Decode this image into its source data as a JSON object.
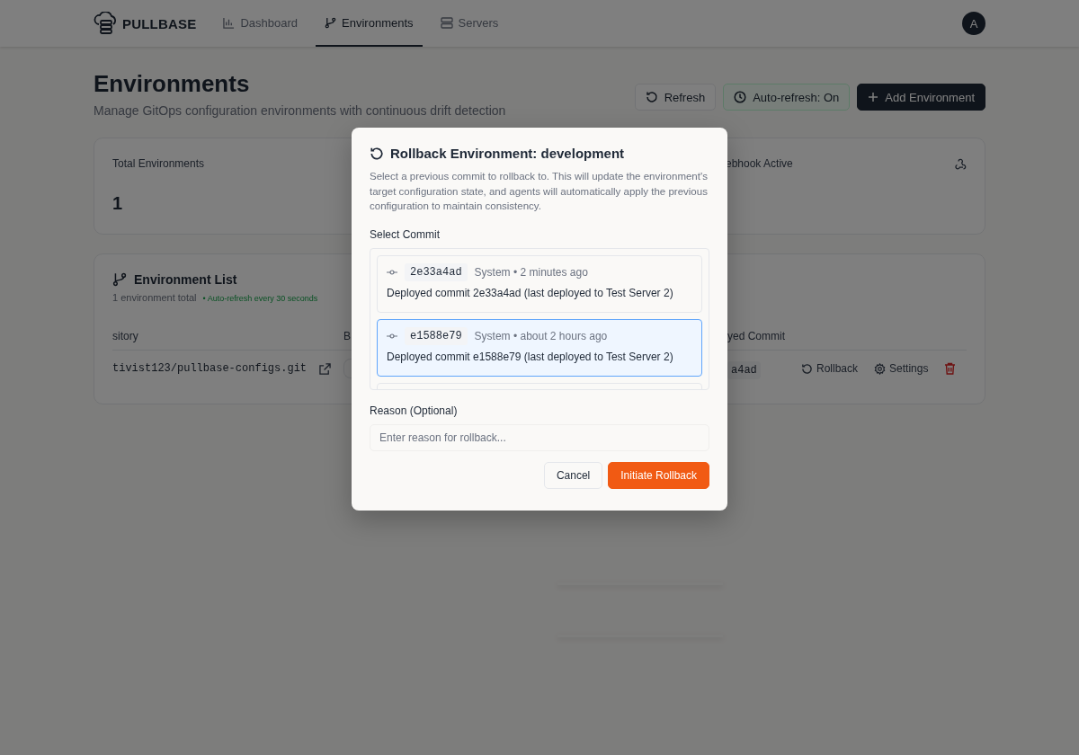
{
  "header": {
    "logo": "PULLBASE",
    "nav": [
      {
        "label": "Dashboard",
        "kind": "chart",
        "selected": false
      },
      {
        "label": "Environments",
        "kind": "branch",
        "selected": true
      },
      {
        "label": "Servers",
        "kind": "server",
        "selected": false
      }
    ],
    "avatar": "A"
  },
  "page": {
    "title": "Environments",
    "subtitle": "Manage GitOps configuration environments with continuous drift detection",
    "buttons": [
      {
        "label": "Refresh",
        "kind": "refresh"
      },
      {
        "label": "Auto-refresh: On",
        "kind": "auto"
      },
      {
        "label": "Add Environment",
        "kind": "add"
      }
    ]
  },
  "stats": [
    {
      "label": "Total Environments",
      "value": "1"
    },
    {
      "label": "ebhook Active"
    }
  ],
  "environment_list": {
    "title": "Environment List",
    "count": "1 environment total",
    "auto_note": "• Auto-refresh every 30 seconds",
    "columns": [
      "sitory",
      "B",
      "yed Commit"
    ],
    "rows": [
      {
        "repository": "tivist123/pullbase-configs.git",
        "commit": "a4ad",
        "actions": [
          "Rollback",
          "Settings"
        ]
      }
    ]
  },
  "dialog": {
    "title": "Rollback Environment: development",
    "description": "Select a previous commit to rollback to. This will update the environment's target configuration state, and agents will automatically apply the previous configuration to maintain consistency.",
    "commit_label": "Select Commit",
    "commits": [
      {
        "hash": "2e33a4ad",
        "meta": "System • 2 minutes ago",
        "message": "Deployed commit 2e33a4ad (last deployed to Test Server 2)",
        "selected": false
      },
      {
        "hash": "e1588e79",
        "meta": "System • about 2 hours ago",
        "message": "Deployed commit e1588e79 (last deployed to Test Server 2)",
        "selected": true
      }
    ],
    "reason_label": "Reason (Optional)",
    "reason_placeholder": "Enter reason for rollback...",
    "buttons": [
      {
        "label": "Cancel",
        "kind": "secondary"
      },
      {
        "label": "Initiate Rollback",
        "kind": "primary"
      }
    ]
  }
}
